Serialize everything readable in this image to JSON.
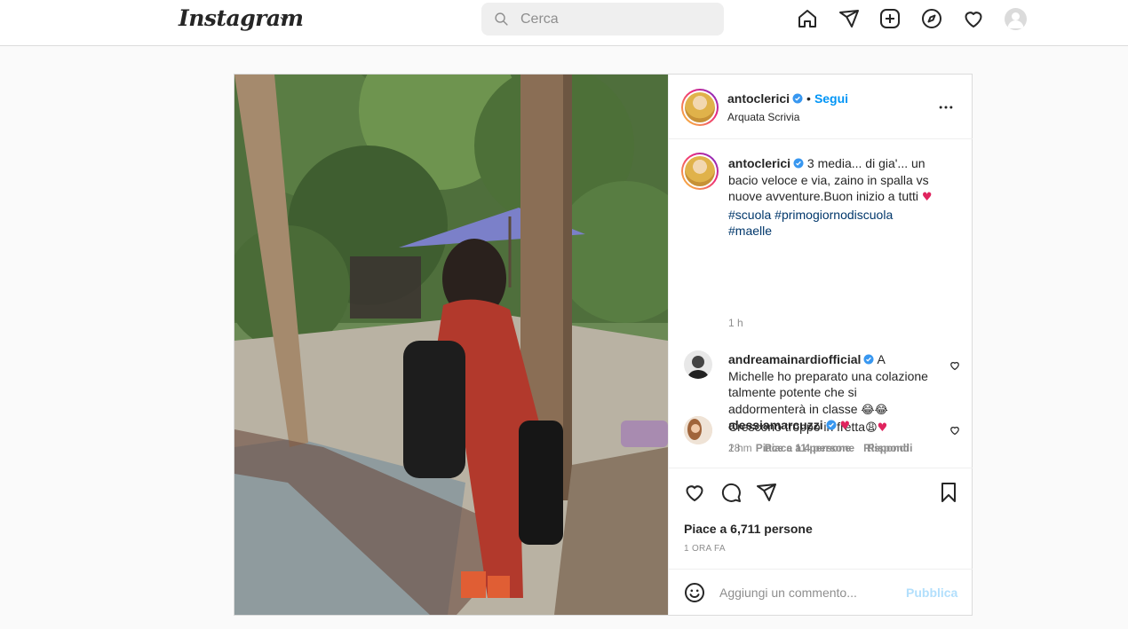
{
  "nav": {
    "logo": "Instagram",
    "search_placeholder": "Cerca"
  },
  "post": {
    "author": "antoclerici",
    "dot": "•",
    "follow_label": "Segui",
    "location": "Arquata Scrivia",
    "caption": {
      "author": "antoclerici",
      "text": "3 media... di gia'... un bacio veloce e via, zaino in spalla vs nuove avventure.Buon inizio a tutti",
      "hashtags": [
        "#scuola",
        "#primogiornodiscuola",
        "#maelle"
      ],
      "time": "1 h"
    },
    "comments": [
      {
        "author": "andreamainardiofficial",
        "text_lines": [
          "A",
          "Michelle ho preparato una colazione",
          "talmente potente che si",
          "addormenterà in classe",
          "Crescono troppo in fretta"
        ],
        "time": "28 m",
        "likes_label": "Piace a 4 persone",
        "reply_label": "Rispondi"
      },
      {
        "author": "alessiamarcuzzi",
        "time": "1 h",
        "likes_label": "Piace a 11 persone",
        "reply_label": "Rispondi"
      }
    ],
    "likes_label": "Piace a 6,711 persone",
    "ago_label": "1 ORA FA",
    "comment_placeholder": "Aggiungi un commento...",
    "publish_label": "Pubblica"
  },
  "colors": {
    "link_blue": "#0095f6",
    "hashtag": "#00376b",
    "muted": "#8e8e8e",
    "border": "#dbdbdb",
    "heart_red": "#e0245e",
    "publish_disabled": "#b2dffc"
  },
  "icons": [
    "home-icon",
    "direct-icon",
    "new-post-icon",
    "explore-icon",
    "activity-heart-icon",
    "search-icon",
    "verified-icon",
    "more-options-icon",
    "like-icon",
    "comment-icon",
    "share-icon",
    "save-icon",
    "emoji-icon"
  ]
}
